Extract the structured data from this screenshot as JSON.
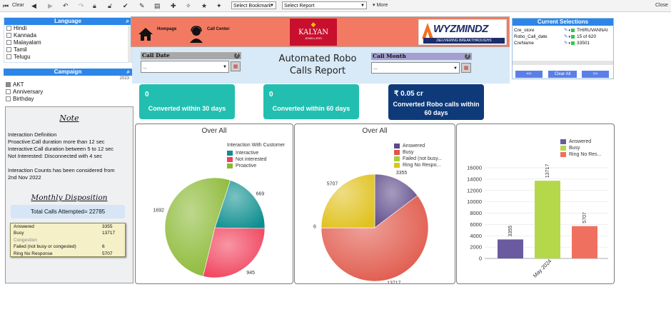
{
  "toolbar": {
    "clear": "Clear",
    "bookmark_select": "Select Bookmark",
    "report_select": "Select Report",
    "more": "More",
    "close": "Close"
  },
  "language_panel": {
    "title": "Language",
    "items": [
      "Hindi",
      "Kannada",
      "Malayalam",
      "Tamil",
      "Telugu"
    ]
  },
  "campaign_panel": {
    "title": "Campaign",
    "year": "2023",
    "items": [
      "AKT",
      "Anniversary",
      "Birthday"
    ]
  },
  "header": {
    "homepage": "Hompage",
    "call_center": "Call Center",
    "kalyan_logo": "KALYAN",
    "kalyan_sub": "JEWELLERS",
    "wyz_logo": "WYZMINDZ",
    "wyz_sub": "DELIVERING   BREAKTHROUGHS"
  },
  "filters": {
    "call_date_label": "Call Date",
    "call_date_value": "...",
    "report_title_line1": "Automated Robo",
    "report_title_line2": "Calls Report",
    "call_month_label": "Call Month",
    "call_month_value": "..."
  },
  "current_selections": {
    "title": "Current Selections",
    "rows": [
      {
        "field": "Cre_store",
        "value": "THIRUVANNAI"
      },
      {
        "field": "Robo_Call_date",
        "value": "15 of 620"
      },
      {
        "field": "CreName",
        "value": "33501"
      }
    ],
    "prev_button": "<<",
    "clear_all_button": "Clear All",
    "next_button": ">>"
  },
  "kpis": [
    {
      "value": "0",
      "label": "Converted within 30 days",
      "color": "#22bfb0"
    },
    {
      "value": "0",
      "label": "Converted within 60 days",
      "color": "#22bfb0"
    },
    {
      "value": "₹ 0.05 cr",
      "label_line1": "Converted Robo calls within",
      "label_line2": "60 days",
      "color": "#0e3a7a"
    }
  ],
  "note": {
    "title": "Note",
    "lines": [
      "Interaction Definition",
      "Proactive:Call duration more than 12 sec",
      "Interactive:Call duration between 5 to 12 sec",
      "Not Interested: Disconnected with 4 sec",
      "",
      "Interaction Counts has been considered from",
      "2nd Nov 2022"
    ]
  },
  "monthly": {
    "title": "Monthly Disposition",
    "total": "Total Calls Attempted= 22785",
    "rows": [
      {
        "label": "Answered",
        "value": "3355"
      },
      {
        "label": "Busy",
        "value": "13717"
      },
      {
        "label": "Congestion",
        "value": ""
      },
      {
        "label": "Failed (not busy or congested)",
        "value": "6"
      },
      {
        "label": "Ring No Response",
        "value": "5707"
      }
    ]
  },
  "chart_data": [
    {
      "type": "pie",
      "title": "Over All",
      "legend_title": "Interaction With Customer",
      "labels": [
        "Interactive",
        "Not interested",
        "Proactive"
      ],
      "values": [
        669,
        945,
        1692
      ],
      "colors": [
        "#0e8f8f",
        "#f0405a",
        "#8ab832"
      ]
    },
    {
      "type": "pie",
      "title": "Over All",
      "labels": [
        "Answered",
        "Busy",
        "Failed (not busy...",
        "Ring No Respo..."
      ],
      "values": [
        3355,
        13717,
        6,
        5707
      ],
      "colors": [
        "#5e4a8a",
        "#e05648",
        "#a8cf3c",
        "#e0c21e"
      ]
    },
    {
      "type": "bar",
      "categories": [
        "May 2024"
      ],
      "series": [
        {
          "name": "Answered",
          "values": [
            3355
          ],
          "color": "#6a5aa0"
        },
        {
          "name": "Busy",
          "values": [
            13717
          ],
          "color": "#b4d84a"
        },
        {
          "name": "Ring No Res...",
          "values": [
            5707
          ],
          "color": "#f07060"
        }
      ],
      "ylim": [
        0,
        16000
      ],
      "yticks": [
        0,
        2000,
        4000,
        6000,
        8000,
        10000,
        12000,
        14000,
        16000
      ]
    }
  ]
}
